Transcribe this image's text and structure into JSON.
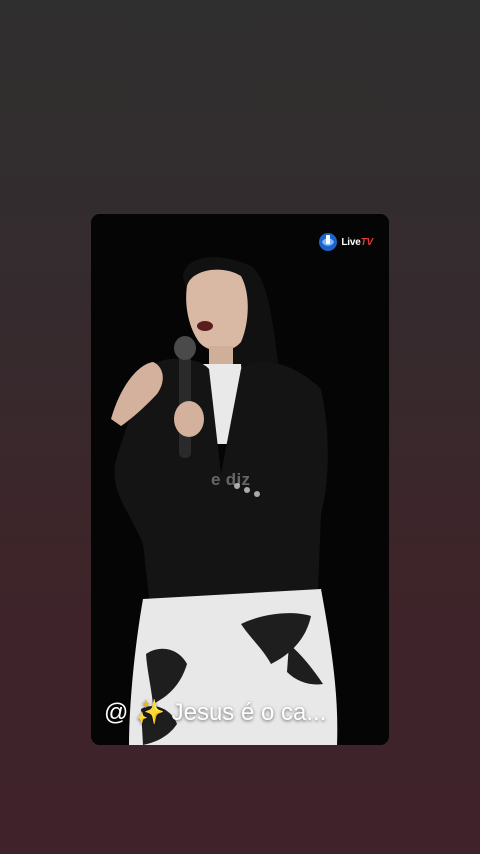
{
  "story": {
    "logo_text": "Live",
    "logo_tv": "TV",
    "overlay_text": "e diz",
    "caption_handle": "@",
    "caption_sparkle": "✨",
    "caption_text": "Jesus é o ca..."
  },
  "colors": {
    "background_top": "#2f2f2f",
    "background_bottom": "#40222a",
    "card_background": "#050505",
    "logo_accent": "#e23b3b"
  }
}
